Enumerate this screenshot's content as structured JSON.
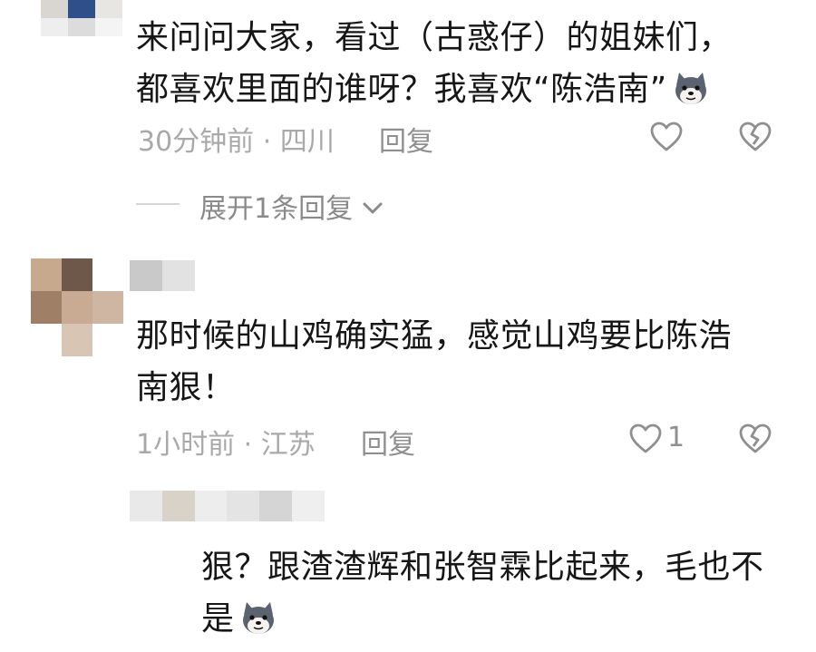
{
  "comments": [
    {
      "text_lines": [
        "来问问大家，看过（古惑仔）的姐妹们，",
        "都喜欢里面的谁呀？我喜欢“陈浩南”"
      ],
      "time": "30分钟前",
      "separator": "·",
      "location": "四川",
      "reply_label": "回复",
      "expand_label": "展开1条回复",
      "emoji": "wolf-emoji"
    },
    {
      "text_lines": [
        "那时候的山鸡确实猛，感觉山鸡要比陈浩",
        "南狠！"
      ],
      "time": "1小时前",
      "separator": "·",
      "location": "江苏",
      "reply_label": "回复",
      "like_count": "1"
    }
  ],
  "reply": {
    "text_lines": [
      "狠？跟渣渣辉和张智霖比起来，毛也不",
      "是"
    ],
    "emoji": "wolf-emoji"
  },
  "icons": {
    "like": "heart-outline-icon",
    "dislike": "broken-heart-icon",
    "expand": "chevron-down-icon"
  },
  "colors": {
    "text": "#161616",
    "meta": "#a9a9a9",
    "icon": "#8f8f8f"
  }
}
